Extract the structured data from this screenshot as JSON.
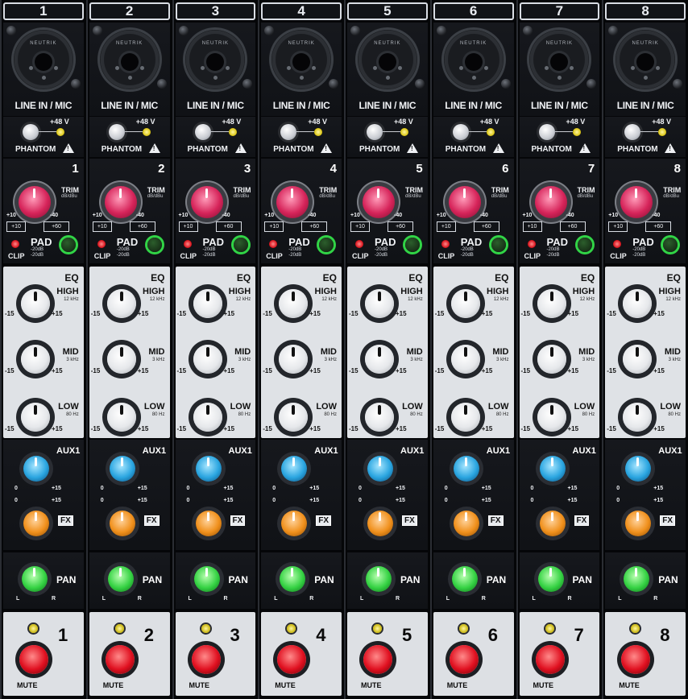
{
  "panel": {
    "channels": [
      {
        "number": "1"
      },
      {
        "number": "2"
      },
      {
        "number": "3"
      },
      {
        "number": "4"
      },
      {
        "number": "5"
      },
      {
        "number": "6"
      },
      {
        "number": "7"
      },
      {
        "number": "8"
      }
    ],
    "labels": {
      "input": "LINE IN / MIC",
      "connector_brand": "NEUTRIK",
      "phantom_voltage": "+48 V",
      "phantom": "PHANTOM",
      "trim": "TRIM",
      "trim_unit": "dB/dBu",
      "trim_left_scale": "+10",
      "trim_right_scale": "-40",
      "trim_left_box": "+10",
      "trim_right_box": "+60",
      "clip": "CLIP",
      "pad": "PAD",
      "pad_sub": "-20dB\n-20dB",
      "eq": "EQ",
      "high": "HIGH",
      "high_freq": "12 kHz",
      "mid": "MID",
      "mid_freq": "3 kHz",
      "low": "LOW",
      "low_freq": "80 Hz",
      "eq_min": "-15",
      "eq_max": "+15",
      "aux1": "AUX1",
      "fx": "FX",
      "send_min": "0",
      "send_max": "+15",
      "pan": "PAN",
      "pan_l": "L",
      "pan_r": "R",
      "mute": "MUTE"
    }
  }
}
